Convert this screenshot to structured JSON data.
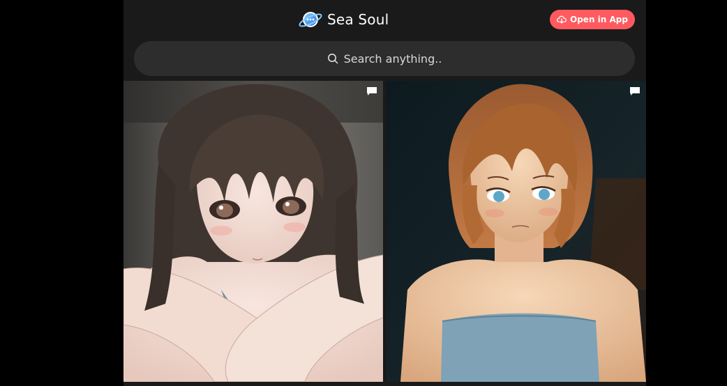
{
  "header": {
    "brand_name": "Sea Soul",
    "logo_icon": "planet-chat-logo-icon",
    "open_app_label": "Open in App",
    "open_app_icon": "cloud-download-icon",
    "open_app_color": "#ff5a5f"
  },
  "search": {
    "placeholder": "Search anything..",
    "icon": "search-icon"
  },
  "cards": [
    {
      "image": "anime-girl-dark-hair-arms-crossed",
      "badge_icon": "chat-bubble-icon"
    },
    {
      "image": "anime-woman-short-auburn-hair-blue-top",
      "badge_icon": "chat-bubble-icon"
    }
  ],
  "colors": {
    "page_background": "#000000",
    "app_background": "#1a1a1a",
    "search_background": "#2d2d2d",
    "accent": "#ff5a5f"
  }
}
